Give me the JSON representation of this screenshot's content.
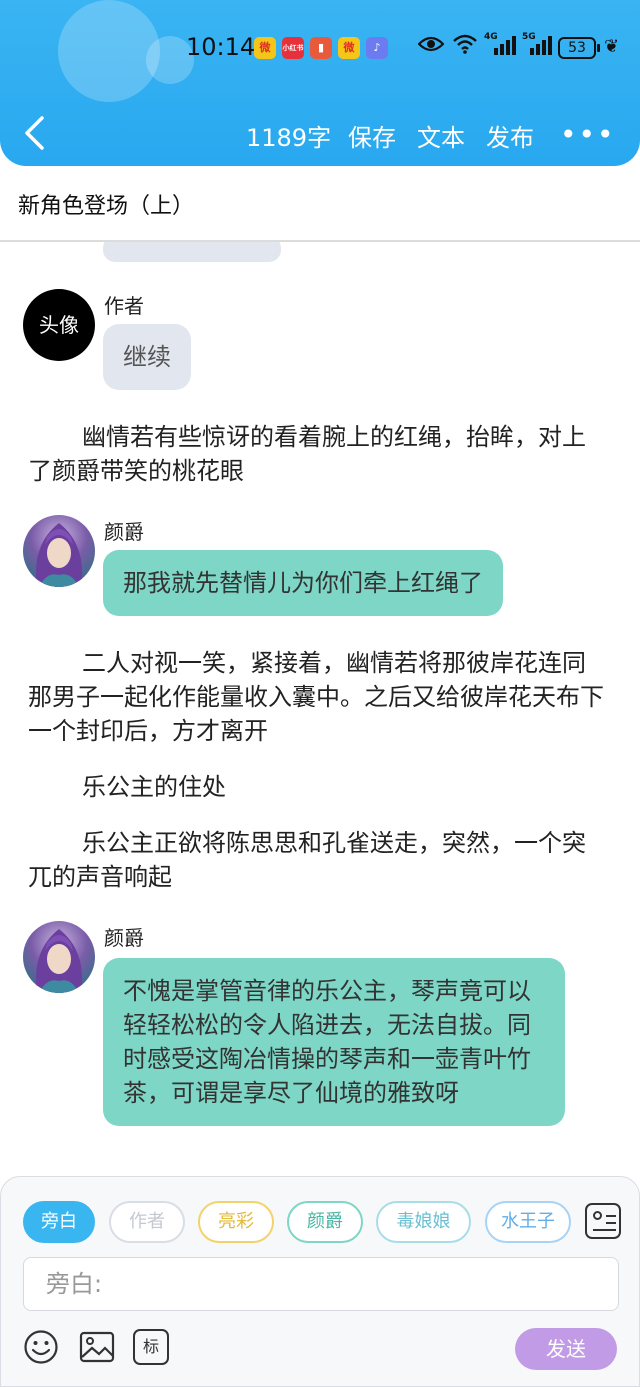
{
  "status_bar": {
    "time": "10:14",
    "notifications": [
      {
        "icon": "weibo-icon",
        "color": "#f5c518",
        "glyph": "微"
      },
      {
        "icon": "xiaohongshu-icon",
        "color": "#e6303c",
        "glyph": "小红书"
      },
      {
        "icon": "app-red-icon",
        "color": "#e85a3c",
        "glyph": "▮"
      },
      {
        "icon": "weibo-icon",
        "color": "#f5c518",
        "glyph": "微"
      },
      {
        "icon": "music-app-icon",
        "color": "#6c7cf0",
        "glyph": "♪"
      }
    ],
    "network_4g": "4G",
    "network_5g": "5G",
    "battery": "53"
  },
  "toolbar": {
    "word_count": "1189字",
    "save_label": "保存",
    "text_label": "文本",
    "publish_label": "发布",
    "more_label": "•••"
  },
  "chapter_title": "新角色登场（上）",
  "messages": [
    {
      "type": "chat",
      "sender": "作者",
      "avatar_text": "头像",
      "text": "继续",
      "style": "grey"
    },
    {
      "type": "narration",
      "text": "幽情若有些惊讶的看着腕上的红绳，抬眸，对上了颜爵带笑的桃花眼"
    },
    {
      "type": "chat",
      "sender": "颜爵",
      "text": "那我就先替情儿为你们牵上红绳了",
      "style": "teal"
    },
    {
      "type": "narration",
      "text": "二人对视一笑，紧接着，幽情若将那彼岸花连同那男子一起化作能量收入囊中。之后又给彼岸花天布下一个封印后，方才离开"
    },
    {
      "type": "narration",
      "text": "乐公主的住处"
    },
    {
      "type": "narration",
      "text": "乐公主正欲将陈思思和孔雀送走，突然，一个突兀的声音响起"
    },
    {
      "type": "chat",
      "sender": "颜爵",
      "text": "不愧是掌管音律的乐公主，琴声竟可以轻轻松松的令人陷进去，无法自拔。同时感受这陶冶情操的琴声和一壶青叶竹茶，可谓是享尽了仙境的雅致呀",
      "style": "teal"
    }
  ],
  "roles": [
    {
      "label": "旁白",
      "color": "#39b6f0",
      "active": true
    },
    {
      "label": "作者",
      "color": "#d8dde6",
      "active": false
    },
    {
      "label": "亮彩",
      "color": "#f2d36b",
      "active": false
    },
    {
      "label": "颜爵",
      "color": "#7dd6c6",
      "active": false
    },
    {
      "label": "毒娘娘",
      "color": "#a8dde8",
      "active": false
    },
    {
      "label": "水王子",
      "color": "#a9d3f5",
      "active": false
    }
  ],
  "input": {
    "placeholder": "旁白:"
  },
  "tools": {
    "emoji": "emoji-icon",
    "image": "image-icon",
    "tag_label": "标"
  },
  "send_label": "发送"
}
